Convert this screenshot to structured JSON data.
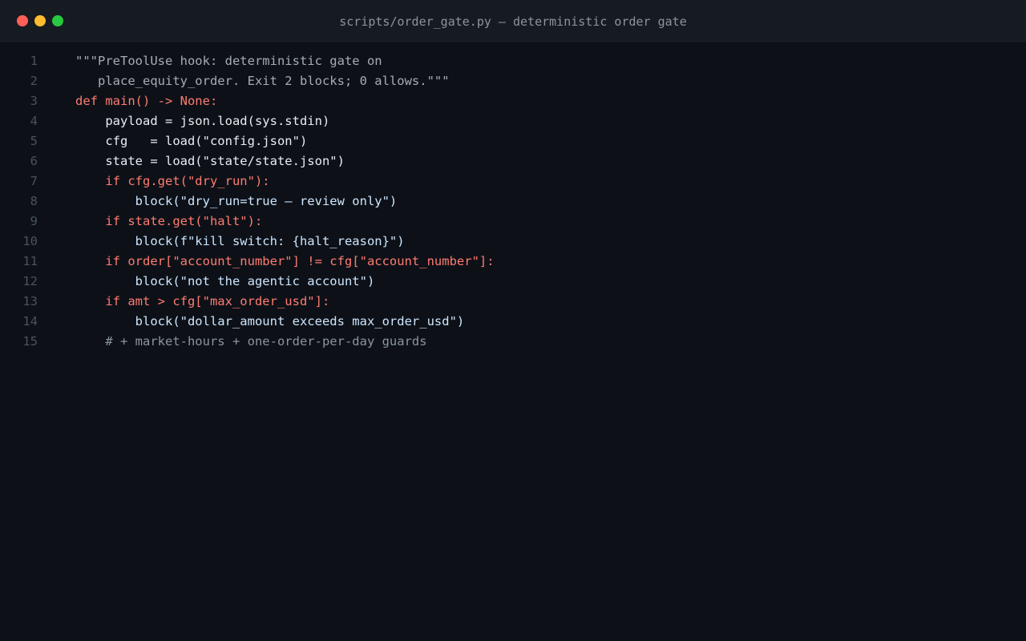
{
  "window": {
    "title": "scripts/order_gate.py — deterministic order gate"
  },
  "editor": {
    "lines": [
      {
        "num": "1",
        "text": "\"\"\"PreToolUse hook: deterministic gate on",
        "kind": "doc"
      },
      {
        "num": "2",
        "text": "   place_equity_order. Exit 2 blocks; 0 allows.\"\"\"",
        "kind": "doc"
      },
      {
        "num": "3",
        "text": "def main() -> None:",
        "kind": "kw"
      },
      {
        "num": "4",
        "text": "    payload = json.load(sys.stdin)",
        "kind": "plain"
      },
      {
        "num": "5",
        "text": "    cfg   = load(\"config.json\")",
        "kind": "plain"
      },
      {
        "num": "6",
        "text": "    state = load(\"state/state.json\")",
        "kind": "plain"
      },
      {
        "num": "7",
        "text": "    if cfg.get(\"dry_run\"):",
        "kind": "kw"
      },
      {
        "num": "8",
        "text": "        block(\"dry_run=true — review only\")",
        "kind": "call"
      },
      {
        "num": "9",
        "text": "    if state.get(\"halt\"):",
        "kind": "kw"
      },
      {
        "num": "10",
        "text": "        block(f\"kill switch: {halt_reason}\")",
        "kind": "call"
      },
      {
        "num": "11",
        "text": "    if order[\"account_number\"] != cfg[\"account_number\"]:",
        "kind": "kw"
      },
      {
        "num": "12",
        "text": "        block(\"not the agentic account\")",
        "kind": "call"
      },
      {
        "num": "13",
        "text": "    if amt > cfg[\"max_order_usd\"]:",
        "kind": "kw"
      },
      {
        "num": "14",
        "text": "        block(\"dollar_amount exceeds max_order_usd\")",
        "kind": "call"
      },
      {
        "num": "15",
        "text": "    # + market-hours + one-order-per-day guards",
        "kind": "comment"
      }
    ]
  }
}
